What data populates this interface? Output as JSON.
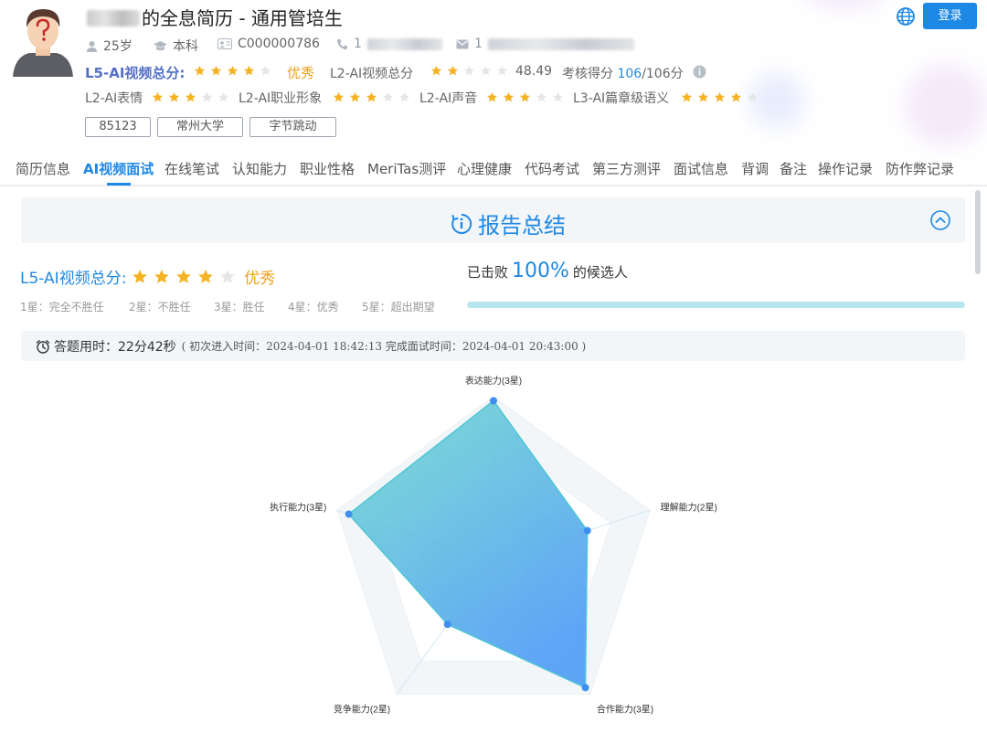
{
  "header": {
    "title_suffix": "的全息简历 - 通用管培生",
    "login_label": "登录",
    "meta": {
      "age": "25岁",
      "education": "本科",
      "candidate_id": "C000000786",
      "phone_prefix": "1",
      "email_prefix": "1"
    },
    "l5": {
      "label": "L5-AI视频总分:",
      "stars_filled": 4,
      "stars_total": 5,
      "rating_text": "优秀"
    },
    "l2_video": {
      "label": "L2-AI视频总分",
      "stars_filled": 2,
      "stars_total": 5,
      "score": "48.49"
    },
    "assessment": {
      "label": "考核得分",
      "score": "106",
      "total": "/106分"
    },
    "sub_scores": [
      {
        "label": "L2-AI表情",
        "stars_filled": 3,
        "stars_total": 5
      },
      {
        "label": "L2-AI职业形象",
        "stars_filled": 3,
        "stars_total": 5
      },
      {
        "label": "L2-AI声音",
        "stars_filled": 3,
        "stars_total": 5
      },
      {
        "label": "L3-AI篇章级语义",
        "stars_filled": 4,
        "stars_total": 5
      }
    ],
    "tags": [
      "85123",
      "常州大学",
      "字节跳动"
    ]
  },
  "tabs": [
    {
      "label": "简历信息",
      "active": false
    },
    {
      "label": "AI视频面试",
      "active": true
    },
    {
      "label": "在线笔试",
      "active": false
    },
    {
      "label": "认知能力",
      "active": false
    },
    {
      "label": "职业性格",
      "active": false
    },
    {
      "label": "MeriTas测评",
      "active": false
    },
    {
      "label": "心理健康",
      "active": false
    },
    {
      "label": "代码考试",
      "active": false
    },
    {
      "label": "第三方测评",
      "active": false
    },
    {
      "label": "面试信息",
      "active": false
    },
    {
      "label": "背调",
      "active": false
    },
    {
      "label": "备注",
      "active": false
    },
    {
      "label": "操作记录",
      "active": false
    },
    {
      "label": "防作弊记录",
      "active": false
    }
  ],
  "report": {
    "title": "报告总结",
    "l5_label": "L5-AI视频总分:",
    "stars_filled": 4,
    "stars_total": 5,
    "rating_text": "优秀",
    "legend": [
      "1星：完全不胜任",
      "2星：不胜任",
      "3星：胜任",
      "4星：优秀",
      "5星：超出期望"
    ],
    "beat_prefix": "已击败",
    "beat_percent": "100%",
    "beat_fraction": 1.0,
    "beat_suffix": "的候选人",
    "time_label": "答题用时：",
    "time_value": "22分42秒",
    "time_detail": "( 初次进入时间：2024-04-01 18:42:13  完成面试时间：2024-04-01 20:43:00 )"
  },
  "colors": {
    "accent": "#1e88e5",
    "star_filled": "#f5b324",
    "star_empty": "#e6e6e6",
    "excellent": "#f0a020",
    "radar_fill_start": "#72dccf",
    "radar_fill_end": "#4f9cf5",
    "radar_point": "#3d8ff0"
  },
  "chart_data": {
    "type": "radar",
    "max": 4,
    "axes": [
      "表达能力(3星)",
      "理解能力(2星)",
      "合作能力(3星)",
      "竞争能力(2星)",
      "执行能力(3星)"
    ],
    "values": [
      3.9,
      2.4,
      3.8,
      1.9,
      3.7
    ]
  }
}
